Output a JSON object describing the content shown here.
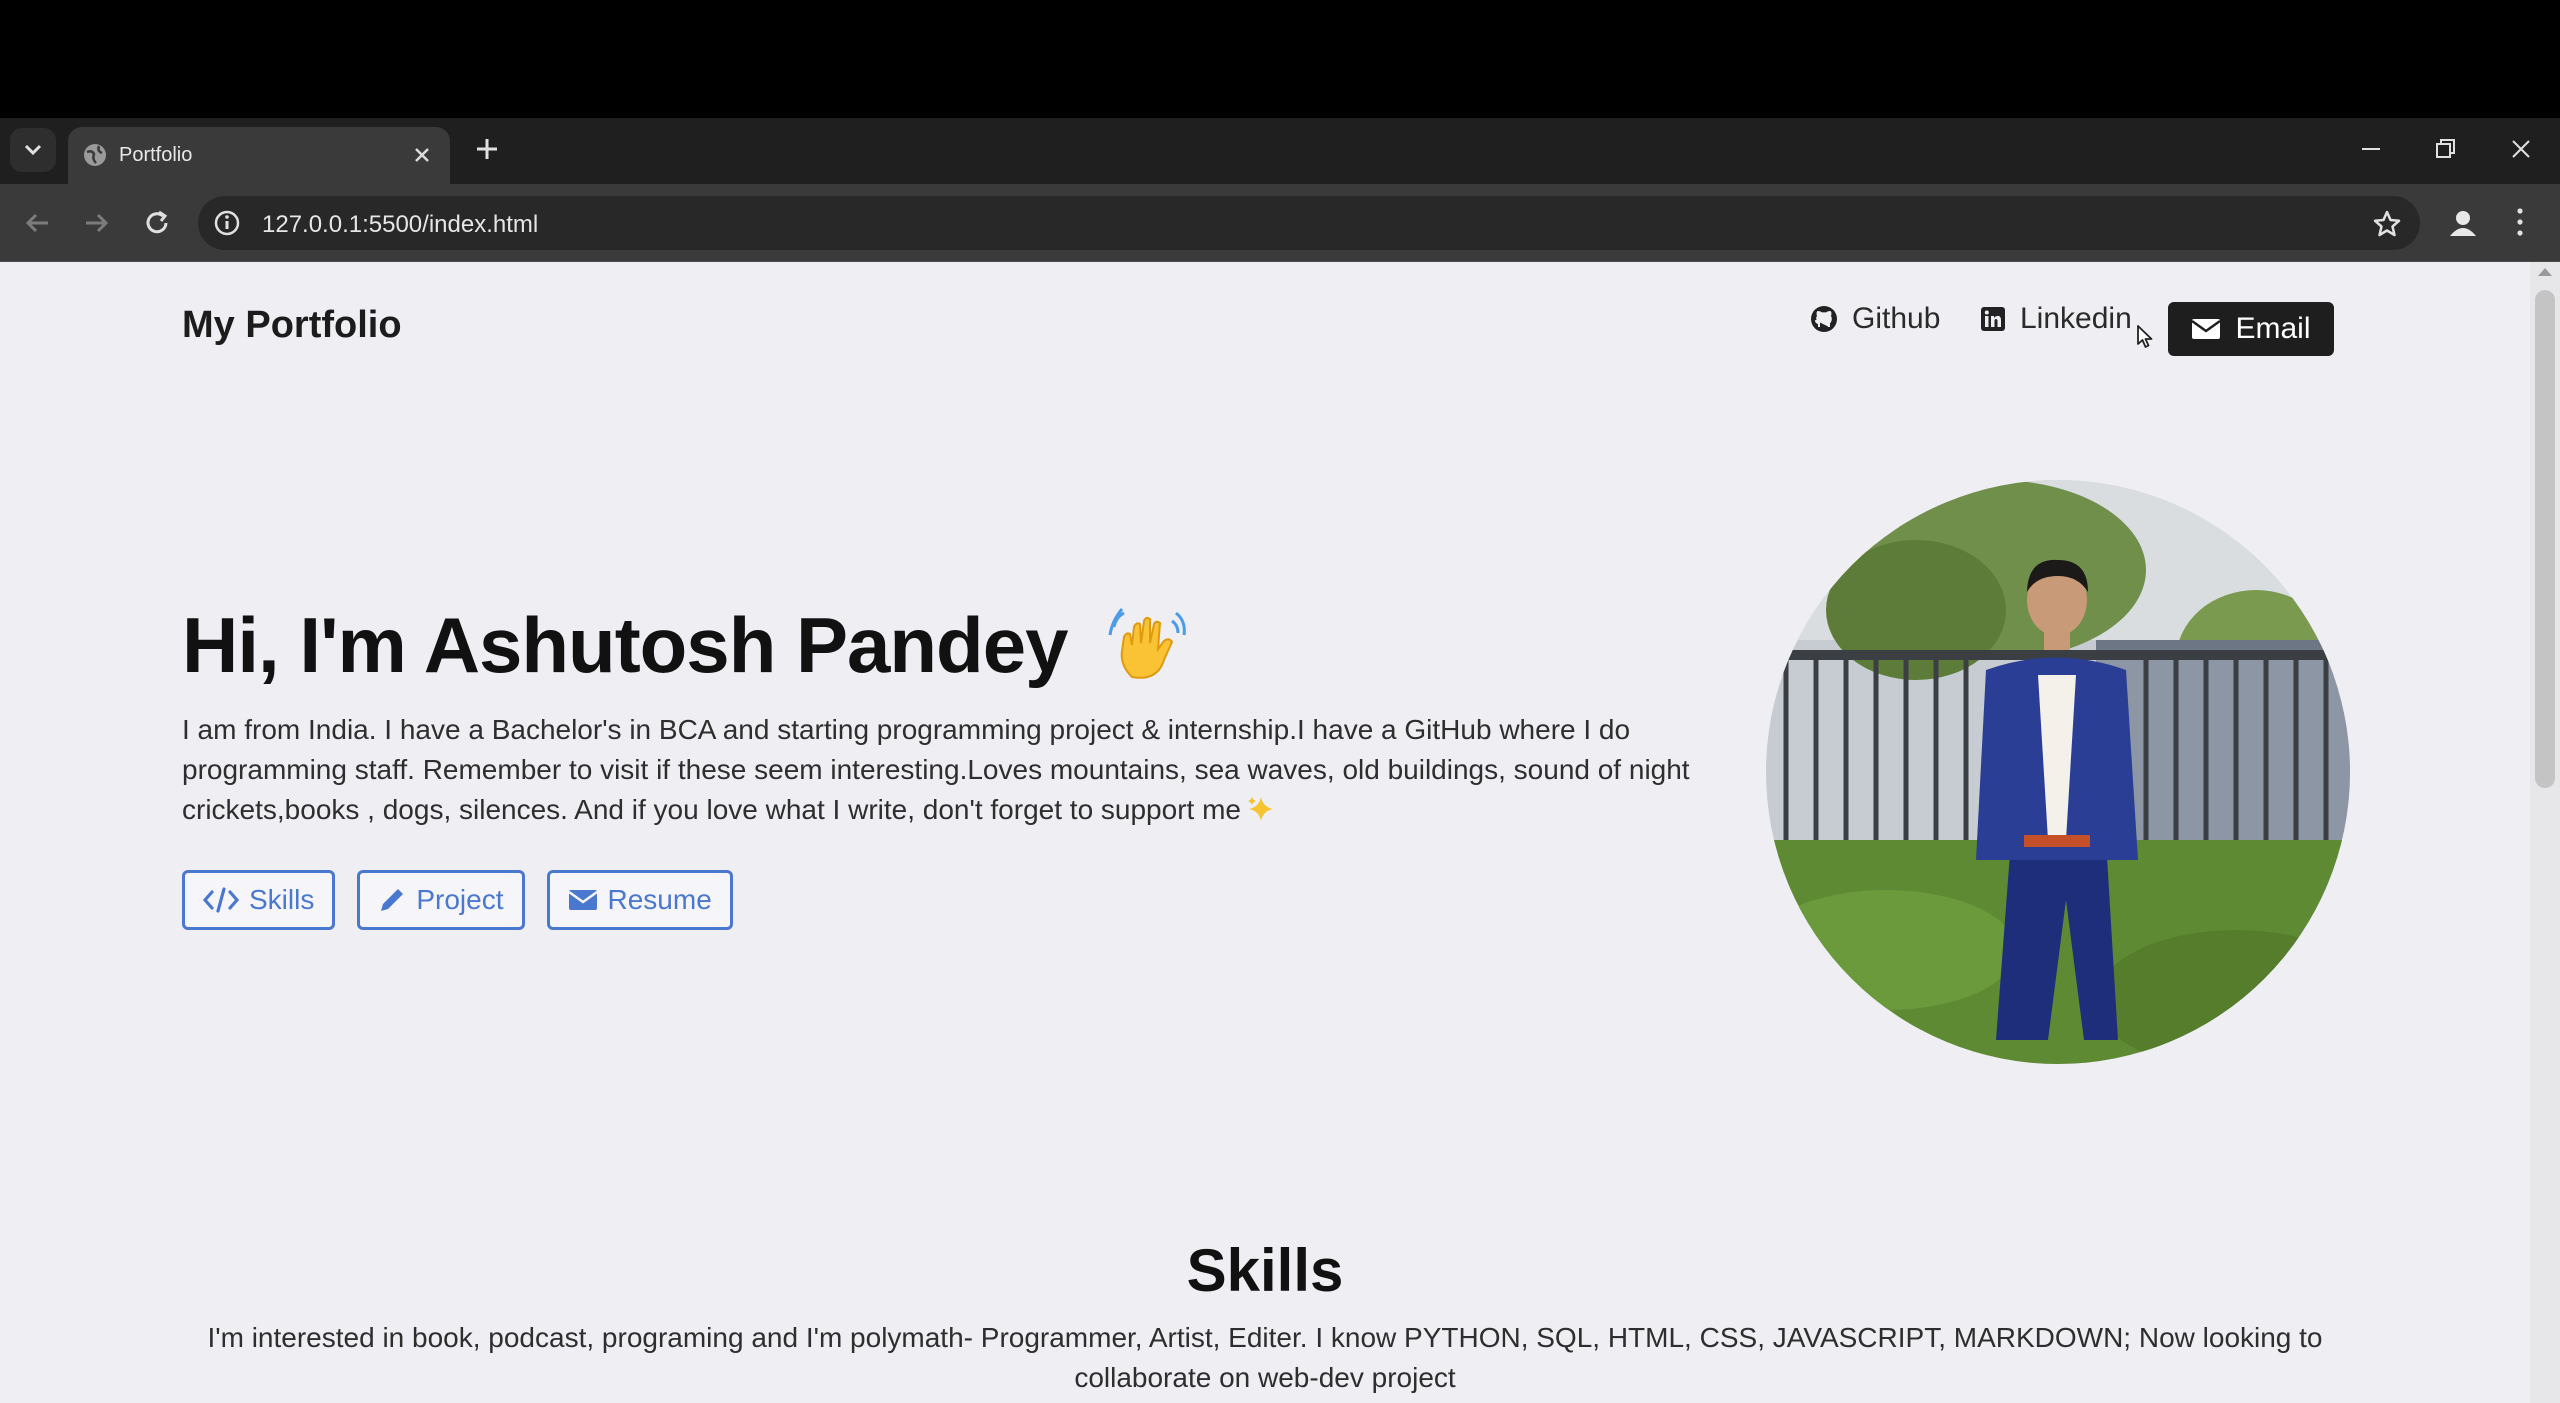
{
  "browser": {
    "tab_title": "Portfolio",
    "url": "127.0.0.1:5500/index.html"
  },
  "header": {
    "brand": "My Portfolio",
    "nav": [
      {
        "label": "Github",
        "icon": "github-icon"
      },
      {
        "label": "Linkedin",
        "icon": "linkedin-icon"
      }
    ],
    "email_label": "Email"
  },
  "hero": {
    "title": "Hi, I'm Ashutosh Pandey",
    "description": "I am from India. I have a Bachelor's in BCA and starting programming project & internship.I have a GitHub where I do programming staff. Remember to visit if these seem interesting.Loves mountains, sea waves, old buildings, sound of night crickets,books , dogs, silences. And if you love what I write, don't forget to support me",
    "buttons": [
      {
        "label": "Skills",
        "icon": "code-icon"
      },
      {
        "label": "Project",
        "icon": "pencil-icon"
      },
      {
        "label": "Resume",
        "icon": "envelope-icon"
      }
    ]
  },
  "skills": {
    "title": "Skills",
    "description": "I'm interested in book, podcast, programing and I'm polymath- Programmer, Artist, Editer. I know PYTHON, SQL, HTML, CSS, JAVASCRIPT, MARKDOWN; Now looking to collaborate on web-dev project"
  },
  "colors": {
    "page_bg": "#eeeef3",
    "accent_blue": "#4a78cf",
    "email_btn_bg": "#1e1e1e"
  }
}
